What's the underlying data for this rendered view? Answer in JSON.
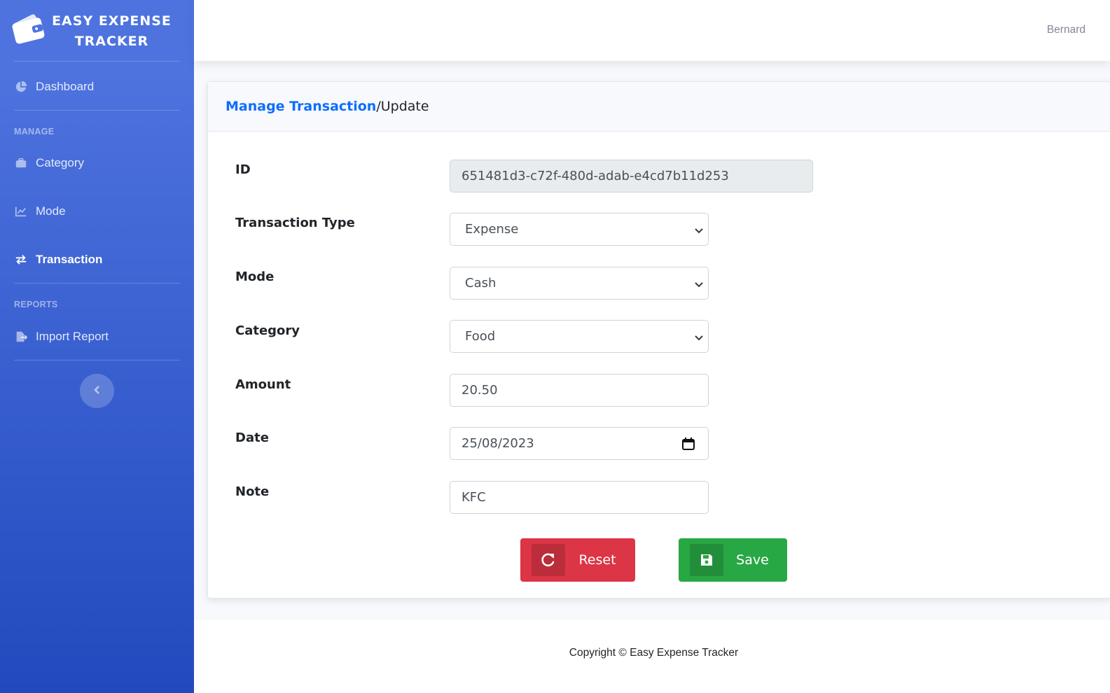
{
  "brand": {
    "line1": "EASY EXPENSE",
    "line2": "TRACKER",
    "icon": "wallet-icon"
  },
  "sidebar": {
    "dashboard": {
      "label": "Dashboard",
      "icon": "chart-pie-icon"
    },
    "manage_heading": "MANAGE",
    "items": [
      {
        "label": "Category",
        "icon": "briefcase-icon"
      },
      {
        "label": "Mode",
        "icon": "chart-line-icon"
      },
      {
        "label": "Transaction",
        "icon": "exchange-icon",
        "active": true
      }
    ],
    "reports_heading": "REPORTS",
    "reports": [
      {
        "label": "Import Report",
        "icon": "file-export-icon"
      }
    ],
    "toggle_icon": "chevron-left-icon"
  },
  "topbar": {
    "user": "Bernard"
  },
  "page": {
    "breadcrumb": {
      "parent": "Manage Transaction",
      "separator": "/",
      "current": "Update"
    }
  },
  "form": {
    "id": {
      "label": "ID",
      "value": "651481d3-c72f-480d-adab-e4cd7b11d253"
    },
    "type": {
      "label": "Transaction Type",
      "value": "Expense"
    },
    "mode": {
      "label": "Mode",
      "value": "Cash"
    },
    "category": {
      "label": "Category",
      "value": "Food"
    },
    "amount": {
      "label": "Amount",
      "value": "20.50"
    },
    "date": {
      "label": "Date",
      "value": "25/08/2023"
    },
    "note": {
      "label": "Note",
      "value": "KFC"
    }
  },
  "buttons": {
    "reset": {
      "label": "Reset",
      "icon": "redo-icon",
      "color": "#dc3545"
    },
    "save": {
      "label": "Save",
      "icon": "floppy-disk-icon",
      "color": "#28a745"
    }
  },
  "footer": {
    "copyright": "Copyright © Easy Expense Tracker"
  },
  "colors": {
    "sidebar_top": "#4e73df",
    "sidebar_bottom": "#224abe",
    "link": "#0d6efd"
  }
}
